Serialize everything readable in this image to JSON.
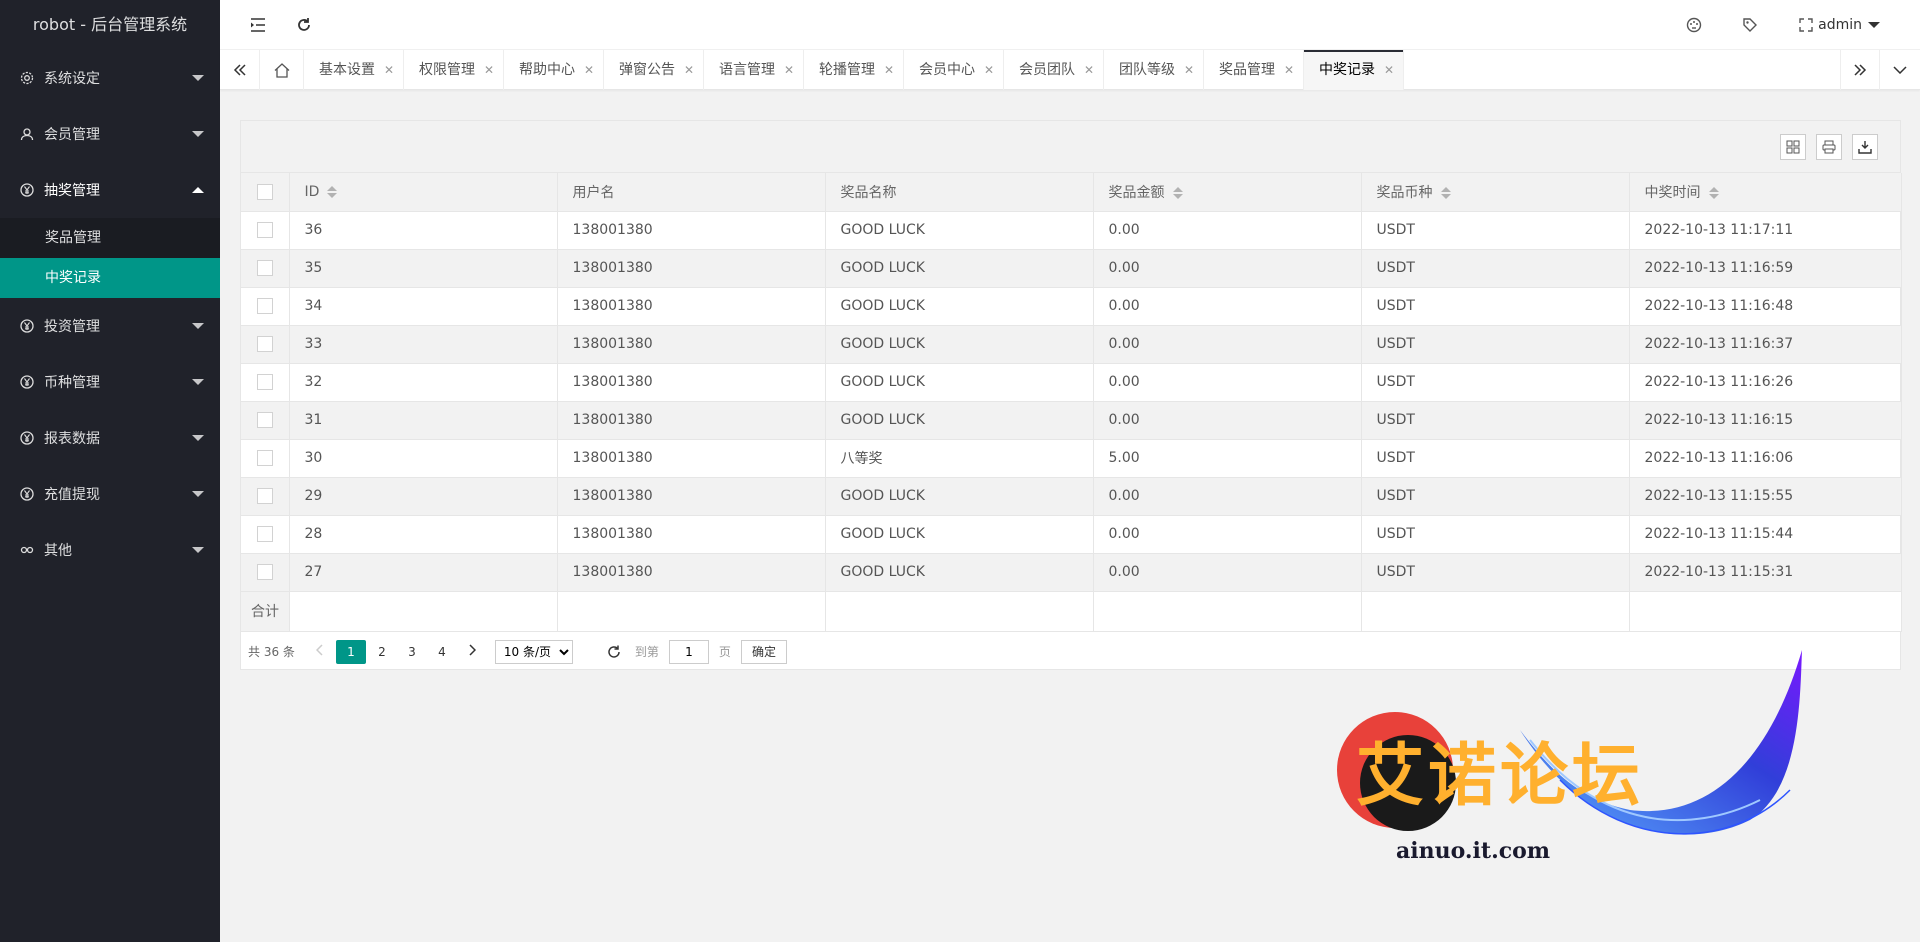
{
  "app": {
    "title": "robot - 后台管理系统"
  },
  "header": {
    "user": "admin"
  },
  "sidebar": {
    "items": [
      {
        "label": "系统设定",
        "icon": "gear-icon"
      },
      {
        "label": "会员管理",
        "icon": "user-icon"
      },
      {
        "label": "抽奖管理",
        "icon": "yen-icon",
        "open": true
      },
      {
        "label": "投资管理",
        "icon": "yen-icon"
      },
      {
        "label": "币种管理",
        "icon": "yen-icon"
      },
      {
        "label": "报表数据",
        "icon": "yen-icon"
      },
      {
        "label": "充值提现",
        "icon": "yen-icon"
      },
      {
        "label": "其他",
        "icon": "link-icon"
      }
    ],
    "sub_items": [
      {
        "label": "奖品管理"
      },
      {
        "label": "中奖记录",
        "active": true
      }
    ]
  },
  "tabs": [
    {
      "label": "基本设置"
    },
    {
      "label": "权限管理"
    },
    {
      "label": "帮助中心"
    },
    {
      "label": "弹窗公告"
    },
    {
      "label": "语言管理"
    },
    {
      "label": "轮播管理"
    },
    {
      "label": "会员中心"
    },
    {
      "label": "会员团队"
    },
    {
      "label": "团队等级"
    },
    {
      "label": "奖品管理"
    },
    {
      "label": "中奖记录",
      "active": true
    }
  ],
  "table": {
    "headers": [
      "ID",
      "用户名",
      "奖品名称",
      "奖品金额",
      "奖品币种",
      "中奖时间"
    ],
    "rows": [
      [
        "36",
        "138001380",
        "GOOD LUCK",
        "0.00",
        "USDT",
        "2022-10-13 11:17:11"
      ],
      [
        "35",
        "138001380",
        "GOOD LUCK",
        "0.00",
        "USDT",
        "2022-10-13 11:16:59"
      ],
      [
        "34",
        "138001380",
        "GOOD LUCK",
        "0.00",
        "USDT",
        "2022-10-13 11:16:48"
      ],
      [
        "33",
        "138001380",
        "GOOD LUCK",
        "0.00",
        "USDT",
        "2022-10-13 11:16:37"
      ],
      [
        "32",
        "138001380",
        "GOOD LUCK",
        "0.00",
        "USDT",
        "2022-10-13 11:16:26"
      ],
      [
        "31",
        "138001380",
        "GOOD LUCK",
        "0.00",
        "USDT",
        "2022-10-13 11:16:15"
      ],
      [
        "30",
        "138001380",
        "八等奖",
        "5.00",
        "USDT",
        "2022-10-13 11:16:06"
      ],
      [
        "29",
        "138001380",
        "GOOD LUCK",
        "0.00",
        "USDT",
        "2022-10-13 11:15:55"
      ],
      [
        "28",
        "138001380",
        "GOOD LUCK",
        "0.00",
        "USDT",
        "2022-10-13 11:15:44"
      ],
      [
        "27",
        "138001380",
        "GOOD LUCK",
        "0.00",
        "USDT",
        "2022-10-13 11:15:31"
      ]
    ],
    "total_label": "合计"
  },
  "pager": {
    "count": "共 36 条",
    "pages": [
      "1",
      "2",
      "3",
      "4"
    ],
    "current": "1",
    "page_size": "10 条/页",
    "goto_label": "到第",
    "goto_value": "1",
    "page_unit": "页",
    "confirm": "确定"
  },
  "watermark": {
    "text": "艾诺论坛",
    "url": "ainuo.it.com"
  },
  "colors": {
    "sidebar": "#20222a",
    "accent": "#009688",
    "watermark": "#ffb02e"
  }
}
